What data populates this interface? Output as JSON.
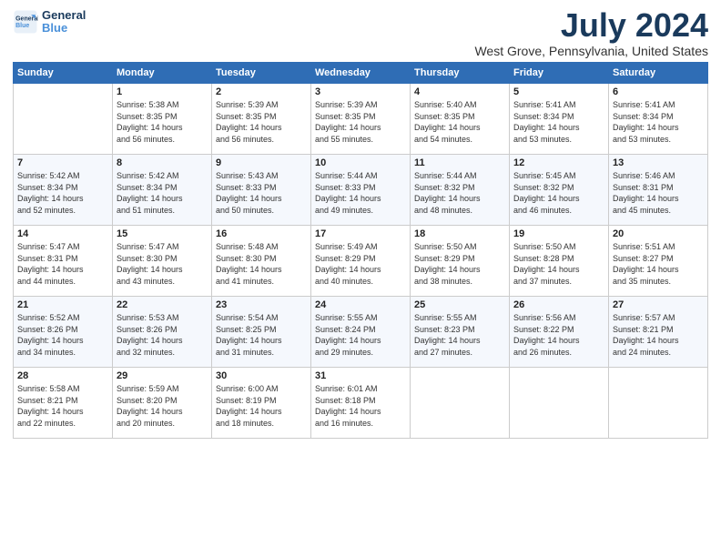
{
  "logo": {
    "line1": "General",
    "line2": "Blue"
  },
  "title": "July 2024",
  "location": "West Grove, Pennsylvania, United States",
  "days_of_week": [
    "Sunday",
    "Monday",
    "Tuesday",
    "Wednesday",
    "Thursday",
    "Friday",
    "Saturday"
  ],
  "weeks": [
    [
      {
        "day": "",
        "info": ""
      },
      {
        "day": "1",
        "info": "Sunrise: 5:38 AM\nSunset: 8:35 PM\nDaylight: 14 hours\nand 56 minutes."
      },
      {
        "day": "2",
        "info": "Sunrise: 5:39 AM\nSunset: 8:35 PM\nDaylight: 14 hours\nand 56 minutes."
      },
      {
        "day": "3",
        "info": "Sunrise: 5:39 AM\nSunset: 8:35 PM\nDaylight: 14 hours\nand 55 minutes."
      },
      {
        "day": "4",
        "info": "Sunrise: 5:40 AM\nSunset: 8:35 PM\nDaylight: 14 hours\nand 54 minutes."
      },
      {
        "day": "5",
        "info": "Sunrise: 5:41 AM\nSunset: 8:34 PM\nDaylight: 14 hours\nand 53 minutes."
      },
      {
        "day": "6",
        "info": "Sunrise: 5:41 AM\nSunset: 8:34 PM\nDaylight: 14 hours\nand 53 minutes."
      }
    ],
    [
      {
        "day": "7",
        "info": "Sunrise: 5:42 AM\nSunset: 8:34 PM\nDaylight: 14 hours\nand 52 minutes."
      },
      {
        "day": "8",
        "info": "Sunrise: 5:42 AM\nSunset: 8:34 PM\nDaylight: 14 hours\nand 51 minutes."
      },
      {
        "day": "9",
        "info": "Sunrise: 5:43 AM\nSunset: 8:33 PM\nDaylight: 14 hours\nand 50 minutes."
      },
      {
        "day": "10",
        "info": "Sunrise: 5:44 AM\nSunset: 8:33 PM\nDaylight: 14 hours\nand 49 minutes."
      },
      {
        "day": "11",
        "info": "Sunrise: 5:44 AM\nSunset: 8:32 PM\nDaylight: 14 hours\nand 48 minutes."
      },
      {
        "day": "12",
        "info": "Sunrise: 5:45 AM\nSunset: 8:32 PM\nDaylight: 14 hours\nand 46 minutes."
      },
      {
        "day": "13",
        "info": "Sunrise: 5:46 AM\nSunset: 8:31 PM\nDaylight: 14 hours\nand 45 minutes."
      }
    ],
    [
      {
        "day": "14",
        "info": "Sunrise: 5:47 AM\nSunset: 8:31 PM\nDaylight: 14 hours\nand 44 minutes."
      },
      {
        "day": "15",
        "info": "Sunrise: 5:47 AM\nSunset: 8:30 PM\nDaylight: 14 hours\nand 43 minutes."
      },
      {
        "day": "16",
        "info": "Sunrise: 5:48 AM\nSunset: 8:30 PM\nDaylight: 14 hours\nand 41 minutes."
      },
      {
        "day": "17",
        "info": "Sunrise: 5:49 AM\nSunset: 8:29 PM\nDaylight: 14 hours\nand 40 minutes."
      },
      {
        "day": "18",
        "info": "Sunrise: 5:50 AM\nSunset: 8:29 PM\nDaylight: 14 hours\nand 38 minutes."
      },
      {
        "day": "19",
        "info": "Sunrise: 5:50 AM\nSunset: 8:28 PM\nDaylight: 14 hours\nand 37 minutes."
      },
      {
        "day": "20",
        "info": "Sunrise: 5:51 AM\nSunset: 8:27 PM\nDaylight: 14 hours\nand 35 minutes."
      }
    ],
    [
      {
        "day": "21",
        "info": "Sunrise: 5:52 AM\nSunset: 8:26 PM\nDaylight: 14 hours\nand 34 minutes."
      },
      {
        "day": "22",
        "info": "Sunrise: 5:53 AM\nSunset: 8:26 PM\nDaylight: 14 hours\nand 32 minutes."
      },
      {
        "day": "23",
        "info": "Sunrise: 5:54 AM\nSunset: 8:25 PM\nDaylight: 14 hours\nand 31 minutes."
      },
      {
        "day": "24",
        "info": "Sunrise: 5:55 AM\nSunset: 8:24 PM\nDaylight: 14 hours\nand 29 minutes."
      },
      {
        "day": "25",
        "info": "Sunrise: 5:55 AM\nSunset: 8:23 PM\nDaylight: 14 hours\nand 27 minutes."
      },
      {
        "day": "26",
        "info": "Sunrise: 5:56 AM\nSunset: 8:22 PM\nDaylight: 14 hours\nand 26 minutes."
      },
      {
        "day": "27",
        "info": "Sunrise: 5:57 AM\nSunset: 8:21 PM\nDaylight: 14 hours\nand 24 minutes."
      }
    ],
    [
      {
        "day": "28",
        "info": "Sunrise: 5:58 AM\nSunset: 8:21 PM\nDaylight: 14 hours\nand 22 minutes."
      },
      {
        "day": "29",
        "info": "Sunrise: 5:59 AM\nSunset: 8:20 PM\nDaylight: 14 hours\nand 20 minutes."
      },
      {
        "day": "30",
        "info": "Sunrise: 6:00 AM\nSunset: 8:19 PM\nDaylight: 14 hours\nand 18 minutes."
      },
      {
        "day": "31",
        "info": "Sunrise: 6:01 AM\nSunset: 8:18 PM\nDaylight: 14 hours\nand 16 minutes."
      },
      {
        "day": "",
        "info": ""
      },
      {
        "day": "",
        "info": ""
      },
      {
        "day": "",
        "info": ""
      }
    ]
  ]
}
